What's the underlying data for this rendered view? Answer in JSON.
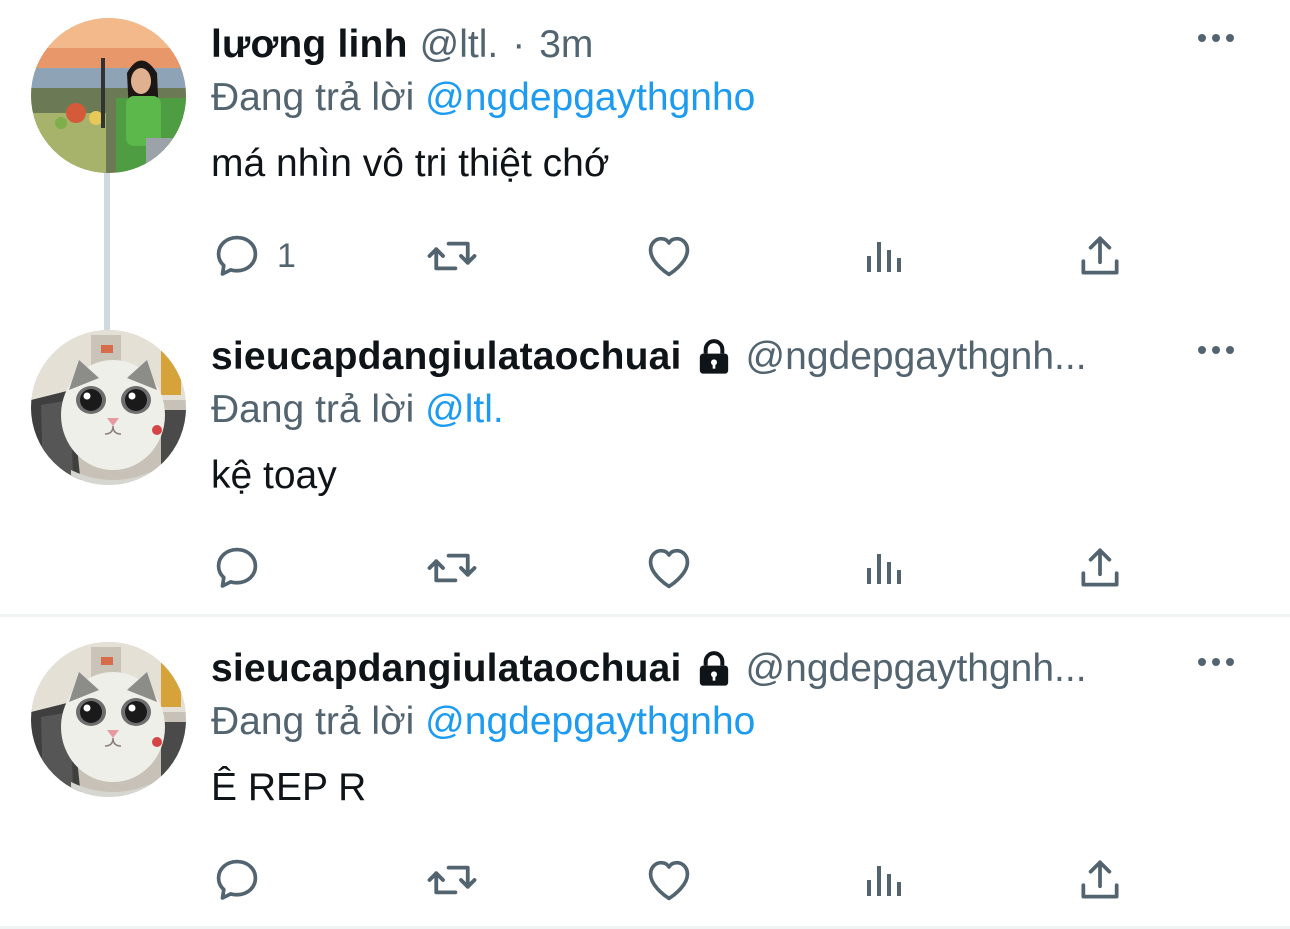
{
  "tweets": [
    {
      "name": "lương linh",
      "handle": "@ltl.",
      "dot": "·",
      "time": "3m",
      "reply_prefix": "Đang trả lời",
      "reply_mention": "@ngdepgaythgnho",
      "text": "má nhìn vô tri thiệt chớ",
      "reply_count": "1",
      "protected": false,
      "avatar_icon": "woman-by-sea-photo"
    },
    {
      "name": "sieucapdangiulataochuai",
      "handle": "@ngdepgaythgnh...",
      "reply_prefix": "Đang trả lời",
      "reply_mention": "@ltl.",
      "text": "kệ toay",
      "reply_count": "",
      "protected": true,
      "avatar_icon": "cat-photo"
    },
    {
      "name": "sieucapdangiulataochuai",
      "handle": "@ngdepgaythgnh...",
      "reply_prefix": "Đang trả lời",
      "reply_mention": "@ngdepgaythgnho",
      "text": "Ê REP R",
      "reply_count": "",
      "protected": true,
      "avatar_icon": "cat-photo"
    }
  ],
  "action_icons": [
    "reply-icon",
    "retweet-icon",
    "like-icon",
    "views-icon",
    "share-icon"
  ],
  "colors": {
    "text": "#0f1419",
    "secondary": "#536471",
    "mention": "#1d9bf0",
    "thread_line": "#cfd9de",
    "divider": "#eff3f4"
  }
}
